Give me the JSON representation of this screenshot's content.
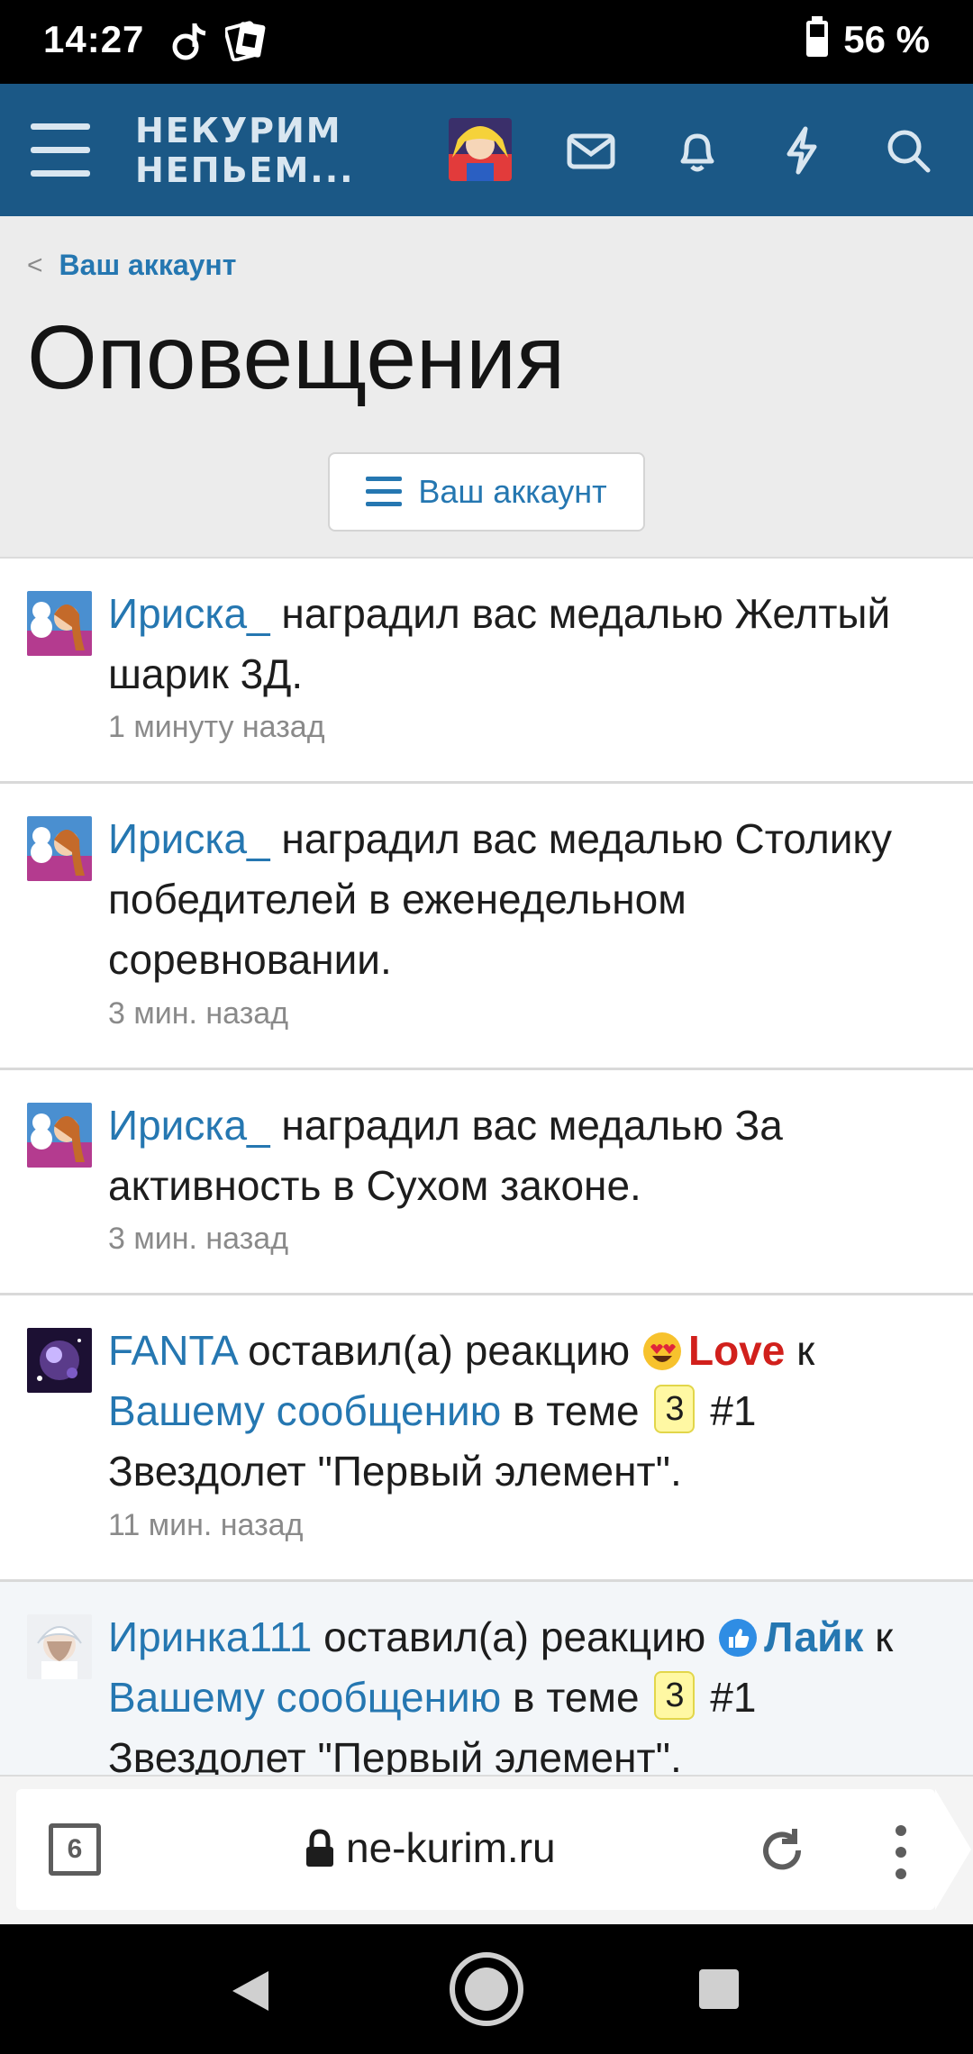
{
  "status_bar": {
    "time": "14:27",
    "battery": "56 %"
  },
  "header": {
    "logo_line1": "НЕКУРИМ",
    "logo_line2": "НЕПЬЕМ..."
  },
  "breadcrumb": {
    "label": "Ваш аккаунт"
  },
  "page": {
    "title": "Оповещения",
    "account_button": "Ваш аккаунт"
  },
  "notifications": [
    {
      "user": "Ириска_",
      "text": " наградил вас медалью Желтый шарик 3Д.",
      "time": "1 минуту назад"
    },
    {
      "user": "Ириска_",
      "text": " наградил вас медалью Столику победителей в еженедельном соревновании.",
      "time": "3 мин. назад"
    },
    {
      "user": "Ириска_",
      "text": " наградил вас медалью За активность в Сухом законе.",
      "time": "3 мин. назад"
    },
    {
      "user": "FANTA",
      "action": " оставил(а) реакцию ",
      "reaction": "Love",
      "to": " к ",
      "link": "Вашему сообщению",
      "in_thread": " в теме ",
      "prefix": "3",
      "thread": " #1 Звездолет \"Первый элемент\".",
      "time": "11 мин. назад"
    },
    {
      "user": "Иринка111",
      "action": " оставил(а) реакцию ",
      "reaction": "Лайк",
      "to": " к ",
      "link": "Вашему сообщению",
      "in_thread": " в теме ",
      "prefix": "3",
      "thread": " #1 Звездолет \"Первый элемент\"."
    }
  ],
  "browser": {
    "tab_count": "6",
    "url": "ne-kurim.ru"
  },
  "icons": [
    "tiktok-icon",
    "sim-icon",
    "battery-icon",
    "menu-icon",
    "mail-icon",
    "bell-icon",
    "lightning-icon",
    "search-icon",
    "lock-icon",
    "reload-icon",
    "more-icon",
    "back-icon",
    "home-icon",
    "recents-icon"
  ],
  "colors": {
    "header_bg": "#1b5886",
    "link": "#2577b1",
    "love": "#d1201c",
    "page_head_bg": "#ececec"
  }
}
